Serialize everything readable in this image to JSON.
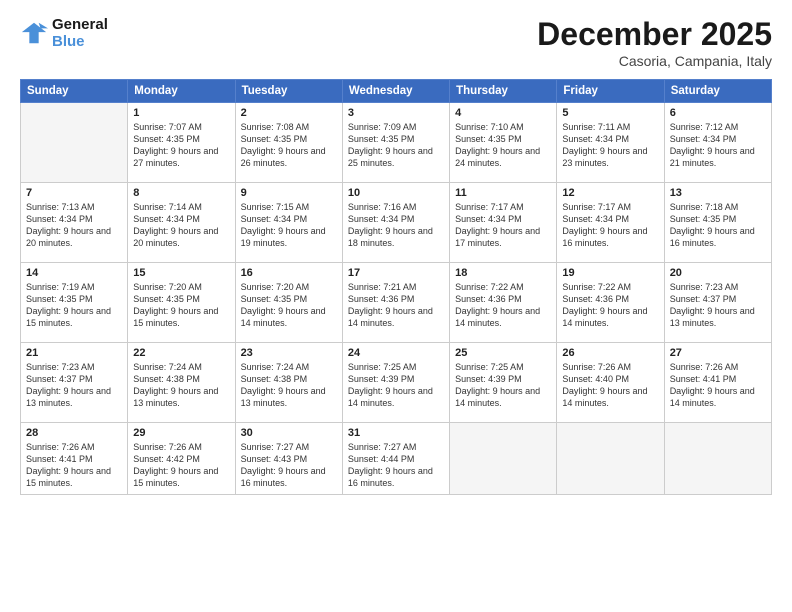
{
  "logo": {
    "line1": "General",
    "line2": "Blue"
  },
  "title": "December 2025",
  "subtitle": "Casoria, Campania, Italy",
  "days_header": [
    "Sunday",
    "Monday",
    "Tuesday",
    "Wednesday",
    "Thursday",
    "Friday",
    "Saturday"
  ],
  "weeks": [
    [
      {
        "num": "",
        "empty": true
      },
      {
        "num": "1",
        "sunrise": "Sunrise: 7:07 AM",
        "sunset": "Sunset: 4:35 PM",
        "daylight": "Daylight: 9 hours and 27 minutes."
      },
      {
        "num": "2",
        "sunrise": "Sunrise: 7:08 AM",
        "sunset": "Sunset: 4:35 PM",
        "daylight": "Daylight: 9 hours and 26 minutes."
      },
      {
        "num": "3",
        "sunrise": "Sunrise: 7:09 AM",
        "sunset": "Sunset: 4:35 PM",
        "daylight": "Daylight: 9 hours and 25 minutes."
      },
      {
        "num": "4",
        "sunrise": "Sunrise: 7:10 AM",
        "sunset": "Sunset: 4:35 PM",
        "daylight": "Daylight: 9 hours and 24 minutes."
      },
      {
        "num": "5",
        "sunrise": "Sunrise: 7:11 AM",
        "sunset": "Sunset: 4:34 PM",
        "daylight": "Daylight: 9 hours and 23 minutes."
      },
      {
        "num": "6",
        "sunrise": "Sunrise: 7:12 AM",
        "sunset": "Sunset: 4:34 PM",
        "daylight": "Daylight: 9 hours and 21 minutes."
      }
    ],
    [
      {
        "num": "7",
        "sunrise": "Sunrise: 7:13 AM",
        "sunset": "Sunset: 4:34 PM",
        "daylight": "Daylight: 9 hours and 20 minutes."
      },
      {
        "num": "8",
        "sunrise": "Sunrise: 7:14 AM",
        "sunset": "Sunset: 4:34 PM",
        "daylight": "Daylight: 9 hours and 20 minutes."
      },
      {
        "num": "9",
        "sunrise": "Sunrise: 7:15 AM",
        "sunset": "Sunset: 4:34 PM",
        "daylight": "Daylight: 9 hours and 19 minutes."
      },
      {
        "num": "10",
        "sunrise": "Sunrise: 7:16 AM",
        "sunset": "Sunset: 4:34 PM",
        "daylight": "Daylight: 9 hours and 18 minutes."
      },
      {
        "num": "11",
        "sunrise": "Sunrise: 7:17 AM",
        "sunset": "Sunset: 4:34 PM",
        "daylight": "Daylight: 9 hours and 17 minutes."
      },
      {
        "num": "12",
        "sunrise": "Sunrise: 7:17 AM",
        "sunset": "Sunset: 4:34 PM",
        "daylight": "Daylight: 9 hours and 16 minutes."
      },
      {
        "num": "13",
        "sunrise": "Sunrise: 7:18 AM",
        "sunset": "Sunset: 4:35 PM",
        "daylight": "Daylight: 9 hours and 16 minutes."
      }
    ],
    [
      {
        "num": "14",
        "sunrise": "Sunrise: 7:19 AM",
        "sunset": "Sunset: 4:35 PM",
        "daylight": "Daylight: 9 hours and 15 minutes."
      },
      {
        "num": "15",
        "sunrise": "Sunrise: 7:20 AM",
        "sunset": "Sunset: 4:35 PM",
        "daylight": "Daylight: 9 hours and 15 minutes."
      },
      {
        "num": "16",
        "sunrise": "Sunrise: 7:20 AM",
        "sunset": "Sunset: 4:35 PM",
        "daylight": "Daylight: 9 hours and 14 minutes."
      },
      {
        "num": "17",
        "sunrise": "Sunrise: 7:21 AM",
        "sunset": "Sunset: 4:36 PM",
        "daylight": "Daylight: 9 hours and 14 minutes."
      },
      {
        "num": "18",
        "sunrise": "Sunrise: 7:22 AM",
        "sunset": "Sunset: 4:36 PM",
        "daylight": "Daylight: 9 hours and 14 minutes."
      },
      {
        "num": "19",
        "sunrise": "Sunrise: 7:22 AM",
        "sunset": "Sunset: 4:36 PM",
        "daylight": "Daylight: 9 hours and 14 minutes."
      },
      {
        "num": "20",
        "sunrise": "Sunrise: 7:23 AM",
        "sunset": "Sunset: 4:37 PM",
        "daylight": "Daylight: 9 hours and 13 minutes."
      }
    ],
    [
      {
        "num": "21",
        "sunrise": "Sunrise: 7:23 AM",
        "sunset": "Sunset: 4:37 PM",
        "daylight": "Daylight: 9 hours and 13 minutes."
      },
      {
        "num": "22",
        "sunrise": "Sunrise: 7:24 AM",
        "sunset": "Sunset: 4:38 PM",
        "daylight": "Daylight: 9 hours and 13 minutes."
      },
      {
        "num": "23",
        "sunrise": "Sunrise: 7:24 AM",
        "sunset": "Sunset: 4:38 PM",
        "daylight": "Daylight: 9 hours and 13 minutes."
      },
      {
        "num": "24",
        "sunrise": "Sunrise: 7:25 AM",
        "sunset": "Sunset: 4:39 PM",
        "daylight": "Daylight: 9 hours and 14 minutes."
      },
      {
        "num": "25",
        "sunrise": "Sunrise: 7:25 AM",
        "sunset": "Sunset: 4:39 PM",
        "daylight": "Daylight: 9 hours and 14 minutes."
      },
      {
        "num": "26",
        "sunrise": "Sunrise: 7:26 AM",
        "sunset": "Sunset: 4:40 PM",
        "daylight": "Daylight: 9 hours and 14 minutes."
      },
      {
        "num": "27",
        "sunrise": "Sunrise: 7:26 AM",
        "sunset": "Sunset: 4:41 PM",
        "daylight": "Daylight: 9 hours and 14 minutes."
      }
    ],
    [
      {
        "num": "28",
        "sunrise": "Sunrise: 7:26 AM",
        "sunset": "Sunset: 4:41 PM",
        "daylight": "Daylight: 9 hours and 15 minutes."
      },
      {
        "num": "29",
        "sunrise": "Sunrise: 7:26 AM",
        "sunset": "Sunset: 4:42 PM",
        "daylight": "Daylight: 9 hours and 15 minutes."
      },
      {
        "num": "30",
        "sunrise": "Sunrise: 7:27 AM",
        "sunset": "Sunset: 4:43 PM",
        "daylight": "Daylight: 9 hours and 16 minutes."
      },
      {
        "num": "31",
        "sunrise": "Sunrise: 7:27 AM",
        "sunset": "Sunset: 4:44 PM",
        "daylight": "Daylight: 9 hours and 16 minutes."
      },
      {
        "num": "",
        "empty": true
      },
      {
        "num": "",
        "empty": true
      },
      {
        "num": "",
        "empty": true
      }
    ]
  ]
}
